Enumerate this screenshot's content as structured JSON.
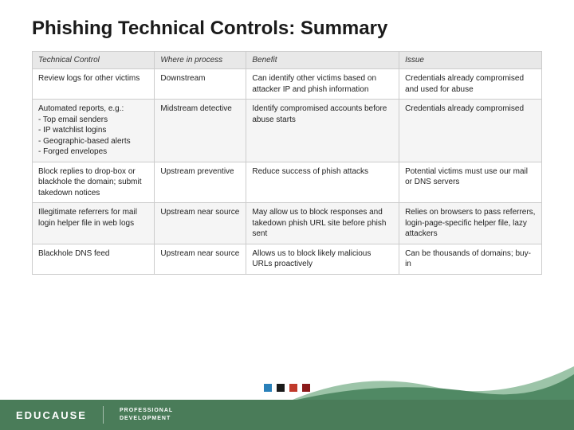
{
  "page": {
    "title": "Phishing Technical Controls: Summary"
  },
  "table": {
    "headers": [
      "Technical Control",
      "Where in process",
      "Benefit",
      "Issue"
    ],
    "rows": [
      {
        "control": "Review logs for other victims",
        "where": "Downstream",
        "benefit": "Can identify other victims based on attacker IP and phish information",
        "issue": "Credentials already compromised and used for abuse"
      },
      {
        "control": "Automated reports, e.g.:\n- Top email senders\n- IP watchlist logins\n- Geographic-based alerts\n- Forged envelopes",
        "where": "Midstream detective",
        "benefit": "Identify compromised accounts before abuse starts",
        "issue": "Credentials already compromised"
      },
      {
        "control": "Block replies to drop-box or blackhole the domain; submit takedown notices",
        "where": "Upstream preventive",
        "benefit": "Reduce success of phish attacks",
        "issue": "Potential victims must use our mail or DNS servers"
      },
      {
        "control": "Illegitimate referrers for mail login helper file in web logs",
        "where": "Upstream near source",
        "benefit": "May allow us to block responses and takedown phish URL site before phish sent",
        "issue": "Relies on browsers to pass referrers, login-page-specific helper file, lazy attackers"
      },
      {
        "control": "Blackhole DNS feed",
        "where": "Upstream near source",
        "benefit": "Allows us to block likely malicious URLs proactively",
        "issue": "Can be thousands of domains; buy-in"
      }
    ]
  },
  "nav_dots": [
    {
      "color": "#2980b9"
    },
    {
      "color": "#1a1a1a"
    },
    {
      "color": "#c0392b"
    },
    {
      "color": "#8b1a1a"
    }
  ],
  "footer": {
    "educause": "EDUCAUSE",
    "professional": "PROFESSIONAL",
    "development": "DEVELOPMENT"
  }
}
